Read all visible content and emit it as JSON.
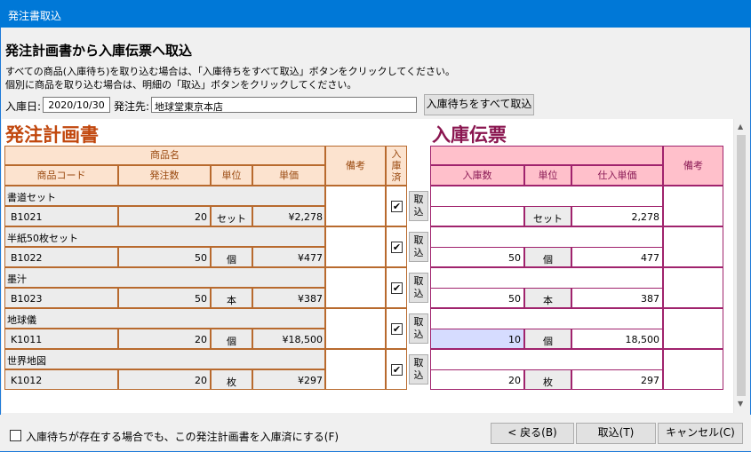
{
  "window": {
    "title": "発注書取込"
  },
  "header": {
    "heading": "発注計画書から入庫伝票へ取込",
    "note1": "すべての商品(入庫待ち)を取り込む場合は、「入庫待ちをすべて取込」ボタンをクリックしてください。",
    "note2": "個別に商品を取り込む場合は、明細の「取込」ボタンをクリックしてください。",
    "date_label": "入庫日:",
    "date_value": "2020/10/30",
    "supplier_label": "発注先:",
    "supplier_value": "地球堂東京本店",
    "bulk_button": "入庫待ちをすべて取込"
  },
  "order": {
    "title": "発注計画書",
    "h_product_name": "商品名",
    "h_remarks": "備考",
    "h_received": "入\n庫\n済",
    "h_code": "商品コード",
    "h_qty": "発注数",
    "h_unit": "単位",
    "h_price": "単価",
    "rows": [
      {
        "name": "書道セット",
        "code": "B1021",
        "qty": "20",
        "unit": "セット",
        "price": "¥2,278",
        "received": true
      },
      {
        "name": "半紙50枚セット",
        "code": "B1022",
        "qty": "50",
        "unit": "個",
        "price": "¥477",
        "received": true
      },
      {
        "name": "墨汁",
        "code": "B1023",
        "qty": "50",
        "unit": "本",
        "price": "¥387",
        "received": true
      },
      {
        "name": "地球儀",
        "code": "K1011",
        "qty": "20",
        "unit": "個",
        "price": "¥18,500",
        "received": true
      },
      {
        "name": "世界地図",
        "code": "K1012",
        "qty": "20",
        "unit": "枚",
        "price": "¥297",
        "received": true
      }
    ]
  },
  "take_button": "取\n込",
  "receipt": {
    "title": "入庫伝票",
    "h_qty": "入庫数",
    "h_unit": "単位",
    "h_cost": "仕入単価",
    "h_remarks": "備考",
    "rows": [
      {
        "qty": "",
        "unit": "セット",
        "cost": "2,278"
      },
      {
        "qty": "50",
        "unit": "個",
        "cost": "477"
      },
      {
        "qty": "50",
        "unit": "本",
        "cost": "387"
      },
      {
        "qty": "10",
        "unit": "個",
        "cost": "18,500"
      },
      {
        "qty": "20",
        "unit": "枚",
        "cost": "297"
      }
    ]
  },
  "footer": {
    "checkbox_label": "入庫待ちが存在する場合でも、この発注計画書を入庫済にする(F)",
    "back_button": "< 戻る(B)",
    "import_button": "取込(T)",
    "cancel_button": "キャンセル(C)"
  },
  "colors": {
    "order_title": "#c1470d",
    "receipt_title": "#8a1650",
    "order_header_bg": "#fce3cf",
    "receipt_header_bg": "#ffc0cb",
    "titlebar": "#0078d7"
  },
  "icons": {
    "checkbox_checked": "check-icon",
    "scroll_up": "arrow-up-icon",
    "scroll_down": "arrow-down-icon"
  }
}
